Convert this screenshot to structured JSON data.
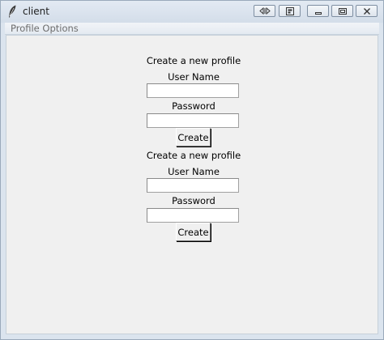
{
  "window": {
    "title": "client",
    "controls": [
      "resize-horizontal-icon",
      "snap-icon",
      "minimize-icon",
      "maximize-icon",
      "close-icon"
    ]
  },
  "menubar": {
    "items": [
      {
        "label": "Profile Options"
      }
    ]
  },
  "forms": [
    {
      "heading": "Create a new profile",
      "username_label": "User Name",
      "username_value": "",
      "password_label": "Password",
      "password_value": "",
      "button_label": "Create"
    },
    {
      "heading": "Create a new profile",
      "username_label": "User Name",
      "username_value": "",
      "password_label": "Password",
      "password_value": "",
      "button_label": "Create"
    }
  ],
  "colors": {
    "client_background": "#f0f0f0",
    "titlebar": "#d3dde9",
    "menu_text_disabled": "#6d6d6d"
  }
}
